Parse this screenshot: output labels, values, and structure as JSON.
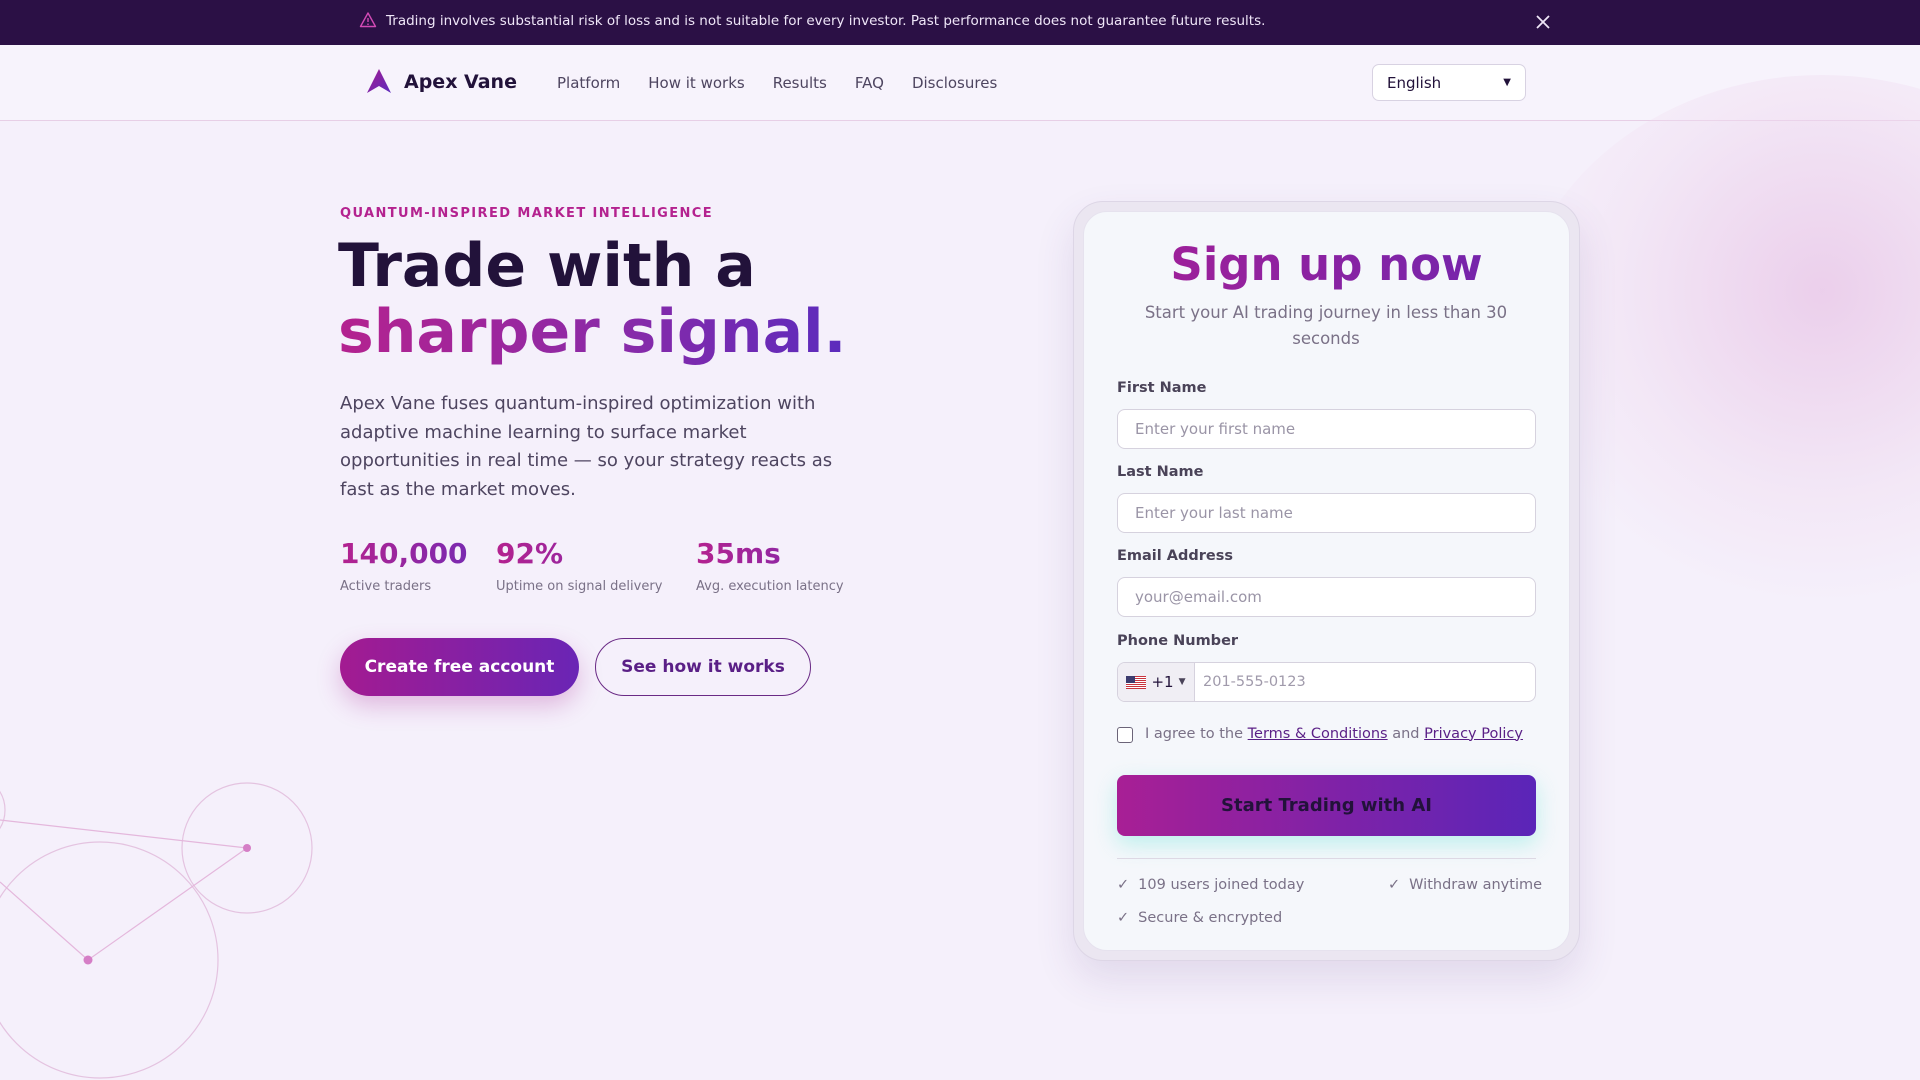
{
  "banner": {
    "text": "Trading involves substantial risk of loss and is not suitable for every investor. Past performance does not guarantee future results.",
    "warn_icon": "warning-triangle-icon",
    "close_icon": "close-icon"
  },
  "nav": {
    "brand": "Apex Vane",
    "links": [
      "Platform",
      "How it works",
      "Results",
      "FAQ",
      "Disclosures"
    ],
    "language": "English"
  },
  "hero": {
    "eyebrow": "QUANTUM-INSPIRED MARKET INTELLIGENCE",
    "headline_line1": "Trade with a",
    "headline_line2": "sharper signal.",
    "lead": "Apex Vane fuses quantum-inspired optimization with adaptive machine learning to surface market opportunities in real time — so your strategy reacts as fast as the market moves.",
    "stats": [
      {
        "value": "140,000",
        "label": "Active traders"
      },
      {
        "value": "92%",
        "label": "Uptime on signal delivery"
      },
      {
        "value": "35ms",
        "label": "Avg. execution latency"
      }
    ],
    "cta_primary": "Create free account",
    "cta_secondary": "See how it works"
  },
  "form": {
    "title": "Sign up now",
    "subtitle": "Start your AI trading journey in less than 30 seconds",
    "first_name": {
      "label": "First Name",
      "placeholder": "Enter your first name",
      "value": ""
    },
    "last_name": {
      "label": "Last Name",
      "placeholder": "Enter your last name",
      "value": ""
    },
    "email": {
      "label": "Email Address",
      "placeholder": "your@email.com",
      "value": ""
    },
    "phone": {
      "label": "Phone Number",
      "country_code": "+1",
      "placeholder": "201-555-0123",
      "value": ""
    },
    "agree_prefix": "I agree to the",
    "terms_link": "Terms & Conditions",
    "agree_and": "and",
    "privacy_link": "Privacy Policy",
    "agree_checked": false,
    "submit": "Start Trading with AI",
    "perks": [
      "109 users joined today",
      "Withdraw anytime",
      "Secure & encrypted"
    ]
  },
  "colors": {
    "banner_bg": "#2b1045",
    "accent_magenta": "#b4228f",
    "accent_purple": "#5b2bbd",
    "text_dark": "#22123a",
    "page_bg": "#f5f0fb"
  }
}
